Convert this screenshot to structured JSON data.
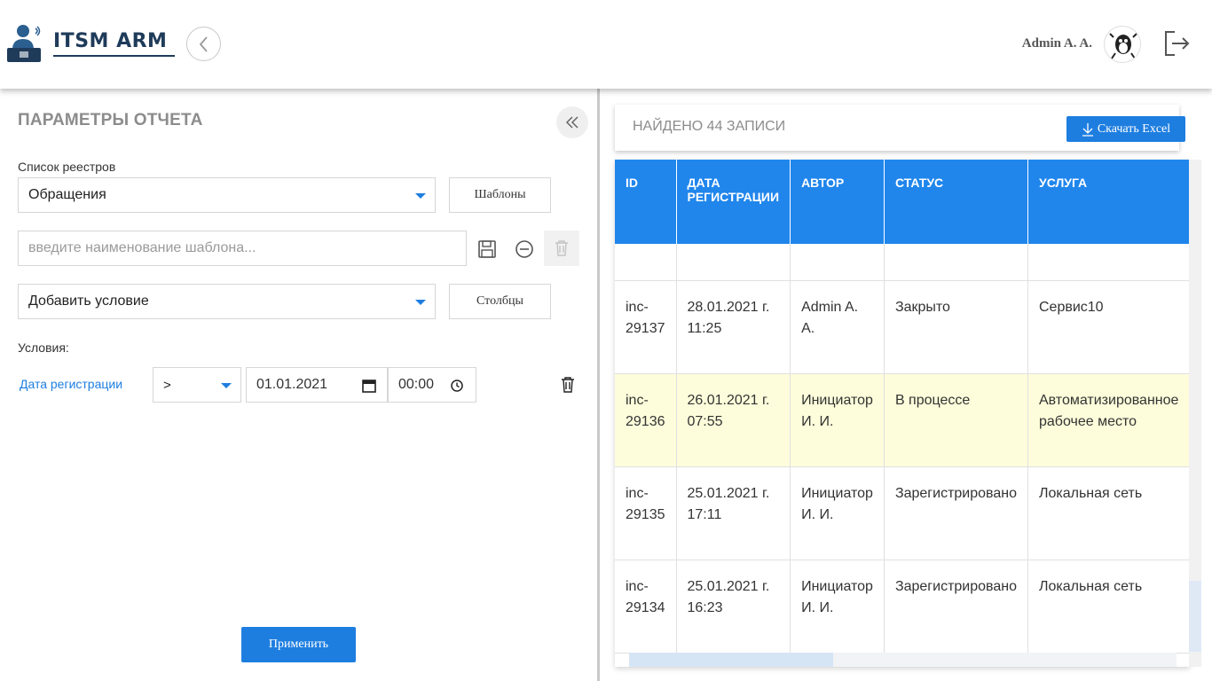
{
  "header": {
    "logo_text": "ITSM ARM",
    "user_name": "Admin A. A."
  },
  "left_panel": {
    "title": "ПАРАМЕТРЫ ОТЧЕТА",
    "registry_label": "Список реестров",
    "registry_value": "Обращения",
    "templates_button": "Шаблоны",
    "template_placeholder": "введите наименование шаблона...",
    "add_condition_value": "Добавить условие",
    "columns_button": "Столбцы",
    "conditions_label": "Условия:",
    "condition": {
      "field": "Дата регистрации",
      "operator": ">",
      "date": "01.01.2021",
      "time": "00:00"
    },
    "apply_button": "Применить"
  },
  "right_panel": {
    "results_count": "НАЙДЕНО 44 ЗАПИСИ",
    "excel_button": "Скачать Excel",
    "columns": [
      "ID",
      "ДАТА РЕГИСТРАЦИИ",
      "АВТОР",
      "СТАТУС",
      "УСЛУГА"
    ],
    "rows": [
      {
        "id": "inc-29137",
        "date": "28.01.2021 г. 11:25",
        "author": "Admin A. A.",
        "status": "Закрыто",
        "service": "Сервис10"
      },
      {
        "id": "inc-29136",
        "date": "26.01.2021 г. 07:55",
        "author": "Инициатор И. И.",
        "status": "В процессе",
        "service": "Автоматизированное рабочее место"
      },
      {
        "id": "inc-29135",
        "date": "25.01.2021 г. 17:11",
        "author": "Инициатор И. И.",
        "status": "Зарегистрировано",
        "service": "Локальная сеть"
      },
      {
        "id": "inc-29134",
        "date": "25.01.2021 г. 16:23",
        "author": "Инициатор И. И.",
        "status": "Зарегистрировано",
        "service": "Локальная сеть"
      }
    ]
  },
  "colors": {
    "accent": "#1e7ee0",
    "table_header": "#2086ec",
    "highlight_row": "#fdfddb",
    "logo": "#1f3b5a"
  }
}
